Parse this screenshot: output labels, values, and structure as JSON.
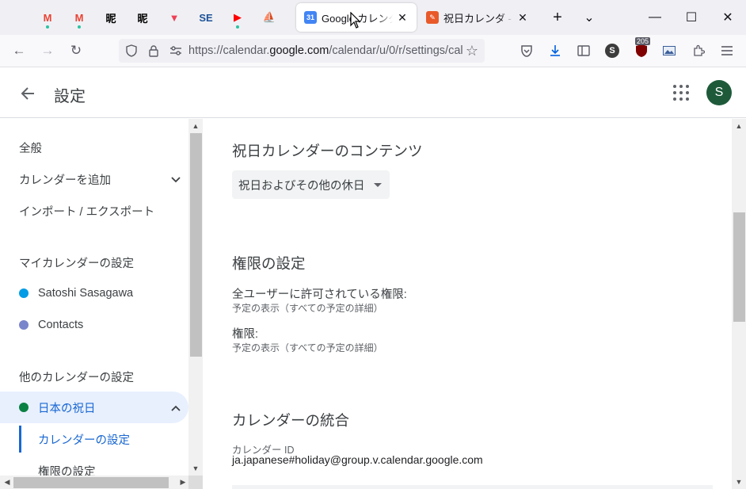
{
  "browser": {
    "pinned_tabs": [
      {
        "name": "gmail-icon",
        "glyph": "M",
        "color": "#ea4335",
        "dot": true
      },
      {
        "name": "gmail-icon",
        "glyph": "M",
        "color": "#ea4335",
        "dot": true
      },
      {
        "name": "kanji-icon",
        "glyph": "昵",
        "color": "#000000",
        "dot": false
      },
      {
        "name": "kanji-icon",
        "glyph": "昵",
        "color": "#000000",
        "dot": false
      },
      {
        "name": "pocket-icon",
        "glyph": "▼",
        "color": "#ef4056",
        "dot": false
      },
      {
        "name": "stackexchange-icon",
        "glyph": "SE",
        "color": "#1e5297",
        "dot": false
      },
      {
        "name": "youtube-icon",
        "glyph": "▶",
        "color": "#ff0000",
        "dot": true
      },
      {
        "name": "sailboat-icon",
        "glyph": "⛵",
        "color": "#e6b800",
        "dot": false
      }
    ],
    "tabs": [
      {
        "title": "Google カレンダー - 設定",
        "favicon": "31",
        "favicon_color": "#4285f4",
        "active": true
      },
      {
        "title": "祝日カレンダ - プロジェクト",
        "favicon": "✎",
        "favicon_color": "#e85a2a",
        "active": false
      }
    ],
    "new_tab_label": "+",
    "list_tabs_label": "⌄",
    "window_controls": {
      "minimize": "—",
      "maximize": "☐",
      "close": "✕"
    },
    "url": {
      "prefix": "https://calendar.",
      "host": "google.com",
      "path": "/calendar/u/0/r/settings/cal"
    },
    "extension_badge": "205"
  },
  "app": {
    "title": "設定",
    "avatar_letter": "S",
    "avatar_color": "#1e5a3a"
  },
  "sidebar": {
    "general": "全般",
    "add_calendar": "カレンダーを追加",
    "import_export": "インポート / エクスポート",
    "my_calendars_heading": "マイカレンダーの設定",
    "my_calendars": [
      {
        "label": "Satoshi Sasagawa",
        "color": "#039be5"
      },
      {
        "label": "Contacts",
        "color": "#7986cb"
      }
    ],
    "other_calendars_heading": "他のカレンダーの設定",
    "selected_calendar": {
      "label": "日本の祝日",
      "color": "#0b8043"
    },
    "sub_items": [
      {
        "label": "カレンダーの設定",
        "active": true
      },
      {
        "label": "権限の設定",
        "active": false
      }
    ]
  },
  "main": {
    "holiday_content_title": "祝日カレンダーのコンテンツ",
    "holiday_content_value": "祝日およびその他の休日",
    "permissions_title": "権限の設定",
    "public_permission_label": "全ユーザーに許可されている権限:",
    "public_permission_value": "予定の表示（すべての予定の詳細）",
    "permission_label": "権限:",
    "permission_value": "予定の表示（すべての予定の詳細）",
    "integration_title": "カレンダーの統合",
    "calendar_id_label": "カレンダー ID",
    "calendar_id_value": "ja.japanese#holiday@group.v.calendar.google.com"
  }
}
